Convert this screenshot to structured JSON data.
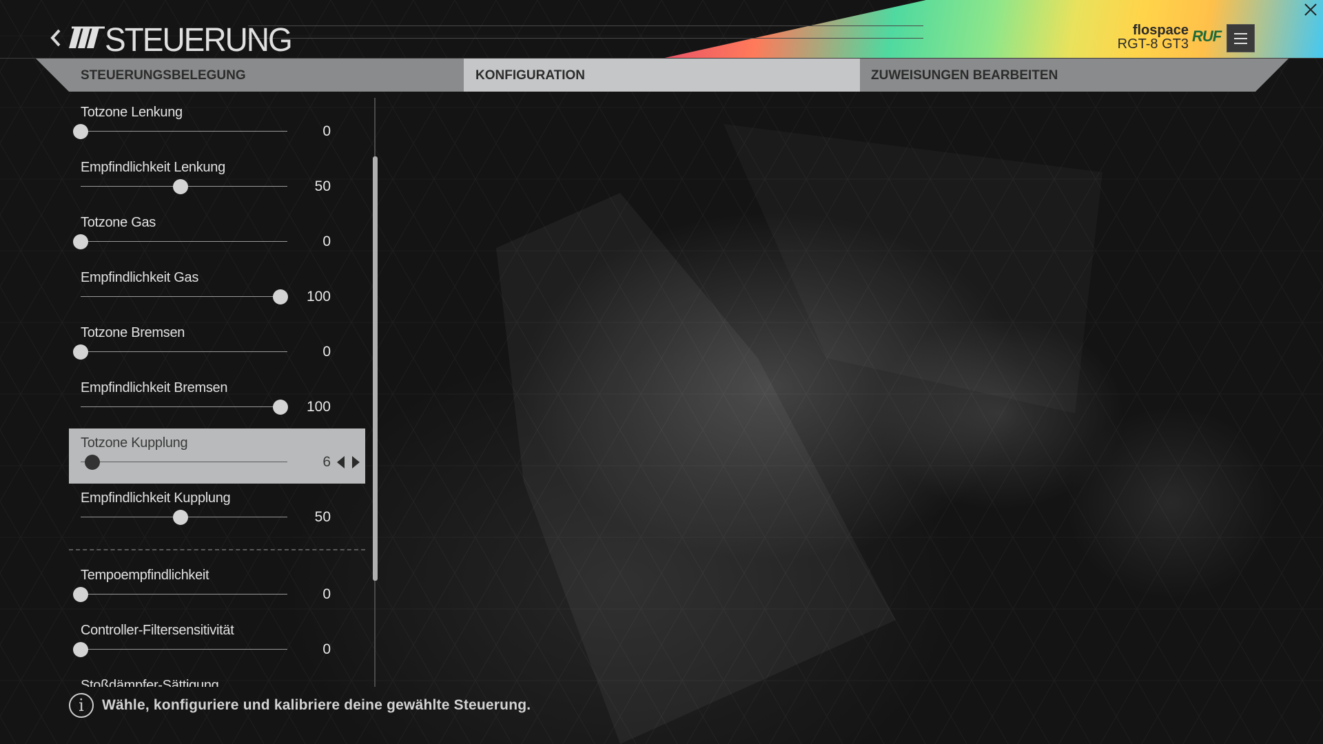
{
  "header": {
    "title": "STEUERUNG",
    "user_name": "flospace",
    "car_name": "RGT-8 GT3",
    "brand": "RUF"
  },
  "tabs": [
    {
      "label": "STEUERUNGSBELEGUNG",
      "active": false
    },
    {
      "label": "KONFIGURATION",
      "active": true
    },
    {
      "label": "ZUWEISUNGEN BEARBEITEN",
      "active": false
    }
  ],
  "settings": [
    {
      "label": "Totzone Lenkung",
      "value": "0",
      "level": 0
    },
    {
      "label": "Empfindlichkeit Lenkung",
      "value": "50",
      "level": 0.5
    },
    {
      "label": "Totzone Gas",
      "value": "0",
      "level": 0
    },
    {
      "label": "Empfindlichkeit Gas",
      "value": "100",
      "level": 1
    },
    {
      "label": "Totzone Bremsen",
      "value": "0",
      "level": 0
    },
    {
      "label": "Empfindlichkeit Bremsen",
      "value": "100",
      "level": 1
    },
    {
      "label": "Totzone Kupplung",
      "value": "6",
      "level": 0.06,
      "selected": true
    },
    {
      "label": "Empfindlichkeit Kupplung",
      "value": "50",
      "level": 0.5
    },
    {
      "label": "Tempoempfindlichkeit",
      "value": "0",
      "level": 0
    },
    {
      "label": "Controller-Filtersensitivität",
      "value": "0",
      "level": 0
    },
    {
      "label": "Stoßdämpfer-Sättigung",
      "value": "",
      "level": 0
    }
  ],
  "footer": {
    "info_text": "Wähle, konfiguriere und kalibriere deine gewählte Steuerung."
  },
  "colors": {
    "accent_tab_active": "#c5c6c7",
    "tab_bar": "#8a8b8c",
    "brand_green": "#1f6a3a"
  },
  "icons": {
    "back": "chevron-left-icon",
    "menu": "hamburger-menu-icon",
    "close": "close-icon",
    "info": "info-icon"
  }
}
